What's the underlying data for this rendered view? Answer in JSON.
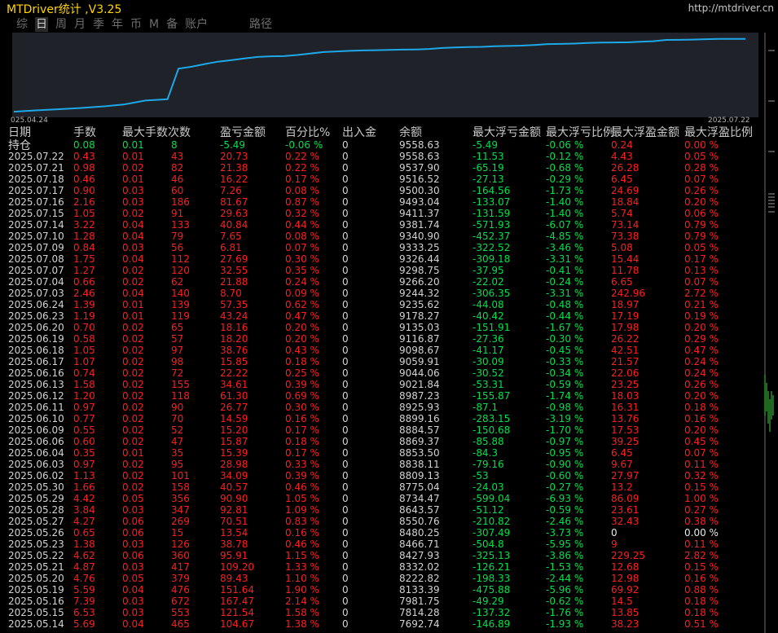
{
  "header": {
    "title": "MTDriver统计 ,V3.25",
    "url": "http://mtdriver.cn"
  },
  "tabs": [
    "综",
    "日",
    "周",
    "月",
    "季",
    "年",
    "币",
    "M",
    "备",
    "账户"
  ],
  "path_tab": "路径",
  "chart": {
    "start_label": "025.04.24",
    "end_label": "2025.07.22",
    "line_color": "#1fa8e8",
    "background": "#1f2229"
  },
  "chart_data": {
    "type": "line",
    "x": [
      "2025.04.24",
      "2025.05.14",
      "2025.05.15",
      "2025.05.16",
      "2025.05.19",
      "2025.05.20",
      "2025.05.21",
      "2025.05.22",
      "2025.05.23",
      "2025.05.26",
      "2025.05.27",
      "2025.05.28",
      "2025.05.29",
      "2025.05.30",
      "2025.06.02",
      "2025.06.03",
      "2025.06.04",
      "2025.06.05",
      "2025.06.06",
      "2025.06.09",
      "2025.06.10",
      "2025.06.11",
      "2025.06.12",
      "2025.06.13",
      "2025.06.16",
      "2025.06.17",
      "2025.06.18",
      "2025.06.19",
      "2025.06.20",
      "2025.06.23",
      "2025.06.24",
      "2025.07.03",
      "2025.07.04",
      "2025.07.07",
      "2025.07.08",
      "2025.07.09",
      "2025.07.10",
      "2025.07.14",
      "2025.07.15",
      "2025.07.16",
      "2025.07.17",
      "2025.07.18",
      "2025.07.21",
      "2025.07.22",
      "持仓"
    ],
    "series": [
      {
        "values": [
          5000,
          7692.74,
          7814.28,
          7981.75,
          8133.39,
          8222.82,
          8332.02,
          8427.93,
          8466.71,
          8480.25,
          8550.76,
          8643.57,
          8734.47,
          8775.04,
          8809.13,
          8838.11,
          8853.5,
          8869.37,
          8884.57,
          8899.16,
          8925.93,
          8987.23,
          9021.84,
          9044.06,
          9059.91,
          9098.67,
          9116.87,
          9135.03,
          9178.27,
          9235.62,
          9244.32,
          9266.2,
          9298.75,
          9326.44,
          9333.25,
          9340.9,
          9381.74,
          9411.37,
          9493.04,
          9500.3,
          9516.52,
          9537.9,
          9558.63,
          9558.63,
          9558.63
        ]
      }
    ],
    "ylim": [
      4800,
      9800
    ],
    "grid": false,
    "legend": "none"
  },
  "table": {
    "columns": [
      "日期",
      "手数",
      "最大手数",
      "次数",
      "盈亏金额",
      "百分比%",
      "出入金",
      "余额",
      "最大浮亏金额",
      "最大浮亏比例",
      "最大浮盈金额",
      "最大浮盈比例"
    ],
    "rows": [
      [
        "持仓",
        "0.08",
        "0.01",
        "8",
        "-5.49",
        "-0.06 %",
        "0",
        "9558.63",
        "-5.49",
        "-0.06 %",
        "0.24",
        "0.00 %"
      ],
      [
        "2025.07.22",
        "0.43",
        "0.01",
        "43",
        "20.73",
        "0.22 %",
        "0",
        "9558.63",
        "-11.53",
        "-0.12 %",
        "4.43",
        "0.05 %"
      ],
      [
        "2025.07.21",
        "0.98",
        "0.02",
        "82",
        "21.38",
        "0.22 %",
        "0",
        "9537.90",
        "-65.19",
        "-0.68 %",
        "26.28",
        "0.28 %"
      ],
      [
        "2025.07.18",
        "0.46",
        "0.01",
        "46",
        "16.22",
        "0.17 %",
        "0",
        "9516.52",
        "-27.13",
        "-0.29 %",
        "6.45",
        "0.07 %"
      ],
      [
        "2025.07.17",
        "0.90",
        "0.03",
        "60",
        "7.26",
        "0.08 %",
        "0",
        "9500.30",
        "-164.56",
        "-1.73 %",
        "24.69",
        "0.26 %"
      ],
      [
        "2025.07.16",
        "2.16",
        "0.03",
        "186",
        "81.67",
        "0.87 %",
        "0",
        "9493.04",
        "-133.07",
        "-1.40 %",
        "18.84",
        "0.20 %"
      ],
      [
        "2025.07.15",
        "1.05",
        "0.02",
        "91",
        "29.63",
        "0.32 %",
        "0",
        "9411.37",
        "-131.59",
        "-1.40 %",
        "5.74",
        "0.06 %"
      ],
      [
        "2025.07.14",
        "3.22",
        "0.04",
        "133",
        "40.84",
        "0.44 %",
        "0",
        "9381.74",
        "-571.93",
        "-6.07 %",
        "73.14",
        "0.79 %"
      ],
      [
        "2025.07.10",
        "1.28",
        "0.04",
        "79",
        "7.65",
        "0.08 %",
        "0",
        "9340.90",
        "-452.37",
        "-4.85 %",
        "73.38",
        "0.79 %"
      ],
      [
        "2025.07.09",
        "0.84",
        "0.03",
        "56",
        "6.81",
        "0.07 %",
        "0",
        "9333.25",
        "-322.52",
        "-3.46 %",
        "5.08",
        "0.05 %"
      ],
      [
        "2025.07.08",
        "1.75",
        "0.04",
        "112",
        "27.69",
        "0.30 %",
        "0",
        "9326.44",
        "-309.18",
        "-3.31 %",
        "15.44",
        "0.17 %"
      ],
      [
        "2025.07.07",
        "1.27",
        "0.02",
        "120",
        "32.55",
        "0.35 %",
        "0",
        "9298.75",
        "-37.95",
        "-0.41 %",
        "11.78",
        "0.13 %"
      ],
      [
        "2025.07.04",
        "0.66",
        "0.02",
        "62",
        "21.88",
        "0.24 %",
        "0",
        "9266.20",
        "-22.02",
        "-0.24 %",
        "6.65",
        "0.07 %"
      ],
      [
        "2025.07.03",
        "2.46",
        "0.04",
        "140",
        "8.70",
        "0.09 %",
        "0",
        "9244.32",
        "-306.35",
        "-3.31 %",
        "242.96",
        "2.72 %"
      ],
      [
        "2025.06.24",
        "1.39",
        "0.01",
        "139",
        "57.35",
        "0.62 %",
        "0",
        "9235.62",
        "-44.08",
        "-0.48 %",
        "18.97",
        "0.21 %"
      ],
      [
        "2025.06.23",
        "1.19",
        "0.01",
        "119",
        "43.24",
        "0.47 %",
        "0",
        "9178.27",
        "-40.42",
        "-0.44 %",
        "17.19",
        "0.19 %"
      ],
      [
        "2025.06.20",
        "0.70",
        "0.02",
        "65",
        "18.16",
        "0.20 %",
        "0",
        "9135.03",
        "-151.91",
        "-1.67 %",
        "17.98",
        "0.20 %"
      ],
      [
        "2025.06.19",
        "0.58",
        "0.02",
        "57",
        "18.20",
        "0.20 %",
        "0",
        "9116.87",
        "-27.36",
        "-0.30 %",
        "26.22",
        "0.29 %"
      ],
      [
        "2025.06.18",
        "1.05",
        "0.02",
        "97",
        "38.76",
        "0.43 %",
        "0",
        "9098.67",
        "-41.17",
        "-0.45 %",
        "42.51",
        "0.47 %"
      ],
      [
        "2025.06.17",
        "1.07",
        "0.02",
        "98",
        "15.85",
        "0.18 %",
        "0",
        "9059.91",
        "-30.09",
        "-0.33 %",
        "21.57",
        "0.24 %"
      ],
      [
        "2025.06.16",
        "0.74",
        "0.02",
        "72",
        "22.22",
        "0.25 %",
        "0",
        "9044.06",
        "-30.52",
        "-0.34 %",
        "22.06",
        "0.24 %"
      ],
      [
        "2025.06.13",
        "1.58",
        "0.02",
        "155",
        "34.61",
        "0.39 %",
        "0",
        "9021.84",
        "-53.31",
        "-0.59 %",
        "23.25",
        "0.26 %"
      ],
      [
        "2025.06.12",
        "1.20",
        "0.02",
        "118",
        "61.30",
        "0.69 %",
        "0",
        "8987.23",
        "-155.87",
        "-1.74 %",
        "18.03",
        "0.20 %"
      ],
      [
        "2025.06.11",
        "0.97",
        "0.02",
        "90",
        "26.77",
        "0.30 %",
        "0",
        "8925.93",
        "-87.1",
        "-0.98 %",
        "16.31",
        "0.18 %"
      ],
      [
        "2025.06.10",
        "0.77",
        "0.02",
        "70",
        "14.59",
        "0.16 %",
        "0",
        "8899.16",
        "-283.15",
        "-3.19 %",
        "13.76",
        "0.16 %"
      ],
      [
        "2025.06.09",
        "0.55",
        "0.02",
        "52",
        "15.20",
        "0.17 %",
        "0",
        "8884.57",
        "-150.68",
        "-1.70 %",
        "17.53",
        "0.20 %"
      ],
      [
        "2025.06.06",
        "0.60",
        "0.02",
        "47",
        "15.87",
        "0.18 %",
        "0",
        "8869.37",
        "-85.88",
        "-0.97 %",
        "39.25",
        "0.45 %"
      ],
      [
        "2025.06.04",
        "0.35",
        "0.01",
        "35",
        "15.39",
        "0.17 %",
        "0",
        "8853.50",
        "-84.3",
        "-0.95 %",
        "6.45",
        "0.07 %"
      ],
      [
        "2025.06.03",
        "0.97",
        "0.02",
        "95",
        "28.98",
        "0.33 %",
        "0",
        "8838.11",
        "-79.16",
        "-0.90 %",
        "9.67",
        "0.11 %"
      ],
      [
        "2025.06.02",
        "1.13",
        "0.02",
        "101",
        "34.09",
        "0.39 %",
        "0",
        "8809.13",
        "-53",
        "-0.60 %",
        "27.97",
        "0.32 %"
      ],
      [
        "2025.05.30",
        "1.66",
        "0.02",
        "158",
        "40.57",
        "0.46 %",
        "0",
        "8775.04",
        "-24.03",
        "-0.27 %",
        "13.2",
        "0.15 %"
      ],
      [
        "2025.05.29",
        "4.42",
        "0.05",
        "356",
        "90.90",
        "1.05 %",
        "0",
        "8734.47",
        "-599.04",
        "-6.93 %",
        "86.09",
        "1.00 %"
      ],
      [
        "2025.05.28",
        "3.84",
        "0.03",
        "347",
        "92.81",
        "1.09 %",
        "0",
        "8643.57",
        "-51.12",
        "-0.59 %",
        "23.61",
        "0.27 %"
      ],
      [
        "2025.05.27",
        "4.27",
        "0.06",
        "269",
        "70.51",
        "0.83 %",
        "0",
        "8550.76",
        "-210.82",
        "-2.46 %",
        "32.43",
        "0.38 %"
      ],
      [
        "2025.05.26",
        "0.65",
        "0.06",
        "15",
        "13.54",
        "0.16 %",
        "0",
        "8480.25",
        "-307.49",
        "-3.73 %",
        "0",
        "0.00 %"
      ],
      [
        "2025.05.23",
        "1.38",
        "0.03",
        "126",
        "38.78",
        "0.46 %",
        "0",
        "8466.71",
        "-504.8",
        "-5.95 %",
        "9",
        "0.11 %"
      ],
      [
        "2025.05.22",
        "4.62",
        "0.06",
        "360",
        "95.91",
        "1.15 %",
        "0",
        "8427.93",
        "-325.13",
        "-3.86 %",
        "229.25",
        "2.82 %"
      ],
      [
        "2025.05.21",
        "4.87",
        "0.03",
        "417",
        "109.20",
        "1.33 %",
        "0",
        "8332.02",
        "-126.21",
        "-1.53 %",
        "12.68",
        "0.15 %"
      ],
      [
        "2025.05.20",
        "4.76",
        "0.05",
        "379",
        "89.43",
        "1.10 %",
        "0",
        "8222.82",
        "-198.33",
        "-2.44 %",
        "12.98",
        "0.16 %"
      ],
      [
        "2025.05.19",
        "5.59",
        "0.04",
        "476",
        "151.64",
        "1.90 %",
        "0",
        "8133.39",
        "-475.88",
        "-5.96 %",
        "69.92",
        "0.88 %"
      ],
      [
        "2025.05.16",
        "7.39",
        "0.03",
        "672",
        "167.47",
        "2.14 %",
        "0",
        "7981.75",
        "-49.29",
        "-0.62 %",
        "14.5",
        "0.18 %"
      ],
      [
        "2025.05.15",
        "6.53",
        "0.03",
        "553",
        "121.54",
        "1.58 %",
        "0",
        "7814.28",
        "-137.32",
        "-1.76 %",
        "13.85",
        "0.18 %"
      ],
      [
        "2025.05.14",
        "5.69",
        "0.04",
        "465",
        "104.67",
        "1.38 %",
        "0",
        "7692.74",
        "-146.89",
        "-1.93 %",
        "38.23",
        "0.51 %"
      ]
    ]
  }
}
